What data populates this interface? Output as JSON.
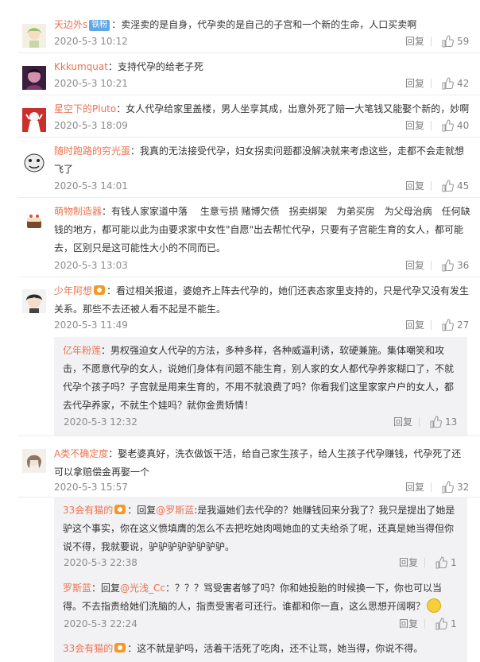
{
  "labels": {
    "reply": "回复"
  },
  "comments": [
    {
      "nick": "天边外s",
      "badge": "铁粉",
      "text": "：卖淫卖的是自身，代孕卖的是自己的子宫和一个新的生命，人口买卖啊",
      "time": "2020-5-3 10:12",
      "likes": "59",
      "avatar": "avatar-cartoon-girl"
    },
    {
      "nick": "Kkkumquat",
      "text": "：支持代孕的给老子死",
      "time": "2020-5-3 10:21",
      "likes": "42",
      "avatar": "avatar-purple-portrait"
    },
    {
      "nick": "星空下的Pluto",
      "text": "：女人代孕给家里盖楼，男人坐享其成，出意外死了赔一大笔钱又能娶个新的，妙啊",
      "time": "2020-5-3 18:09",
      "likes": "40",
      "avatar": "avatar-red-figure"
    },
    {
      "nick": "随时跑路的穷光蛋",
      "text": "：我真的无法接受代孕，妇女拐卖问题都没解决就来考虑这些，走都不会走就想飞了",
      "time": "2020-5-3 14:01",
      "likes": "45",
      "avatar": "avatar-meme-face"
    },
    {
      "nick": "萌物制造器",
      "text": "：有钱人家家道中落　 生意亏损 赌博欠债　拐卖绑架　为弟买房　为父母治病　任何缺钱的地方，都可能以此为由要求家中女性\"自愿\"出去帮忙代孕，只要有子宫能生育的女人，都可能去，区别只是这可能性大小的不同而已。",
      "time": "2020-5-3 13:03",
      "likes": "36",
      "avatar": "avatar-cake"
    },
    {
      "nick": "少年阿想",
      "vip": true,
      "text": "：看过相关报道，婆媳齐上阵去代孕的，她们还表态家里支持的，只是代孕又没有发生关系。那些不去还被人看不起是不能生。",
      "time": "2020-5-3 11:49",
      "likes": "27",
      "avatar": "avatar-anime-boy",
      "replies": [
        {
          "nick": "亿年粉莲",
          "text": "：男权强迫女人代孕的方法，多种多样，各种威逼利诱，软硬兼施。集体嘲笑和攻击，不愿意代孕的女人，说她们身体有问题不能生育，别人家的女人都代孕养家糊口了，不就代孕个孩子吗？子宫就是用来生育的，不用不就浪费了吗？你看我们这里家家户户的女人，都去代孕养家，不就生个娃吗？就你金贵矫情！",
          "time": "2020-5-3 12:32",
          "likes": "13"
        }
      ]
    },
    {
      "nick": "A类不确定度",
      "text": "：娶老婆真好，洗衣做饭干活，给自己家生孩子，给人生孩子代孕赚钱，代孕死了还可以拿赔偿金再娶一个",
      "time": "2020-5-3 15:57",
      "likes": "32",
      "avatar": "avatar-sketch-girl",
      "replies": [
        {
          "nick": "33会有猫的",
          "vip": true,
          "pre": "：回复",
          "mention": "@罗斯蓝",
          "text": ":是我逼她们去代孕的？她赚钱回来分我了？我只是提出了她是驴这个事实，你在这义愤填膺的怎么不去把吃她肉喝她血的丈夫给杀了呢，还真是她当得但你说不得，我就要说，驴驴驴驴驴驴驴驴。",
          "time": "2020-5-3 22:38",
          "likes": "1"
        },
        {
          "nick": "罗斯蓝",
          "pre": "：回复",
          "mention": "@光浅_Cc",
          "text": "：？？？骂受害者够了吗？你和她投胎的时候换一下，你也可以当得。不去指责给她们洗脑的人，指责受害者可还行。谁都和你一直，这么思想开阔啊？",
          "emoji": true,
          "time": "2020-5-3 22:24",
          "likes": "1"
        },
        {
          "nick": "33会有猫的",
          "vip": true,
          "text": "：这不就是驴吗，活着干活死了吃肉，还不让骂，她当得，你说不得。"
        }
      ]
    }
  ]
}
